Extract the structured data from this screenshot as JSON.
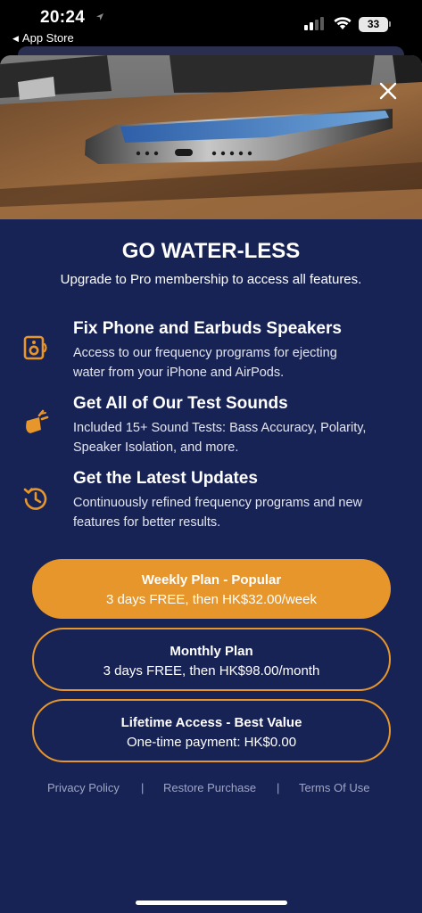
{
  "status_bar": {
    "time": "20:24",
    "back_label": "App Store",
    "battery": "33"
  },
  "hero": {
    "image": "phone-on-table-photo"
  },
  "header": {
    "title": "GO WATER-LESS",
    "subtitle": "Upgrade to Pro membership to access all features."
  },
  "features": [
    {
      "icon": "speaker-icon",
      "title": "Fix Phone and Earbuds Speakers",
      "desc_lines": [
        "Access to our frequency programs for ejecting",
        "water from your iPhone and AirPods."
      ]
    },
    {
      "icon": "sound-test-icon",
      "title": "Get All of Our Test Sounds",
      "desc_lines": [
        "Included 15+ Sound Tests: Bass Accuracy, Polarity,",
        "Speaker Isolation, and more."
      ]
    },
    {
      "icon": "update-clock-icon",
      "title": "Get the Latest Updates",
      "desc_lines": [
        "Continuously refined frequency programs and new",
        "features for better results."
      ]
    }
  ],
  "plans": [
    {
      "name": "Weekly Plan - Popular",
      "price": "3 days FREE, then HK$32.00/week",
      "selected": true
    },
    {
      "name": "Monthly Plan",
      "price": "3 days FREE, then HK$98.00/month",
      "selected": false
    },
    {
      "name": "Lifetime Access - Best Value",
      "price": "One-time payment: HK$0.00",
      "selected": false
    }
  ],
  "footer": {
    "privacy": "Privacy Policy",
    "restore": "Restore Purchase",
    "terms": "Terms Of Use",
    "separator": "|"
  },
  "colors": {
    "background": "#182355",
    "accent": "#e7962c",
    "text": "#ffffff",
    "link": "#9ea5c2"
  }
}
